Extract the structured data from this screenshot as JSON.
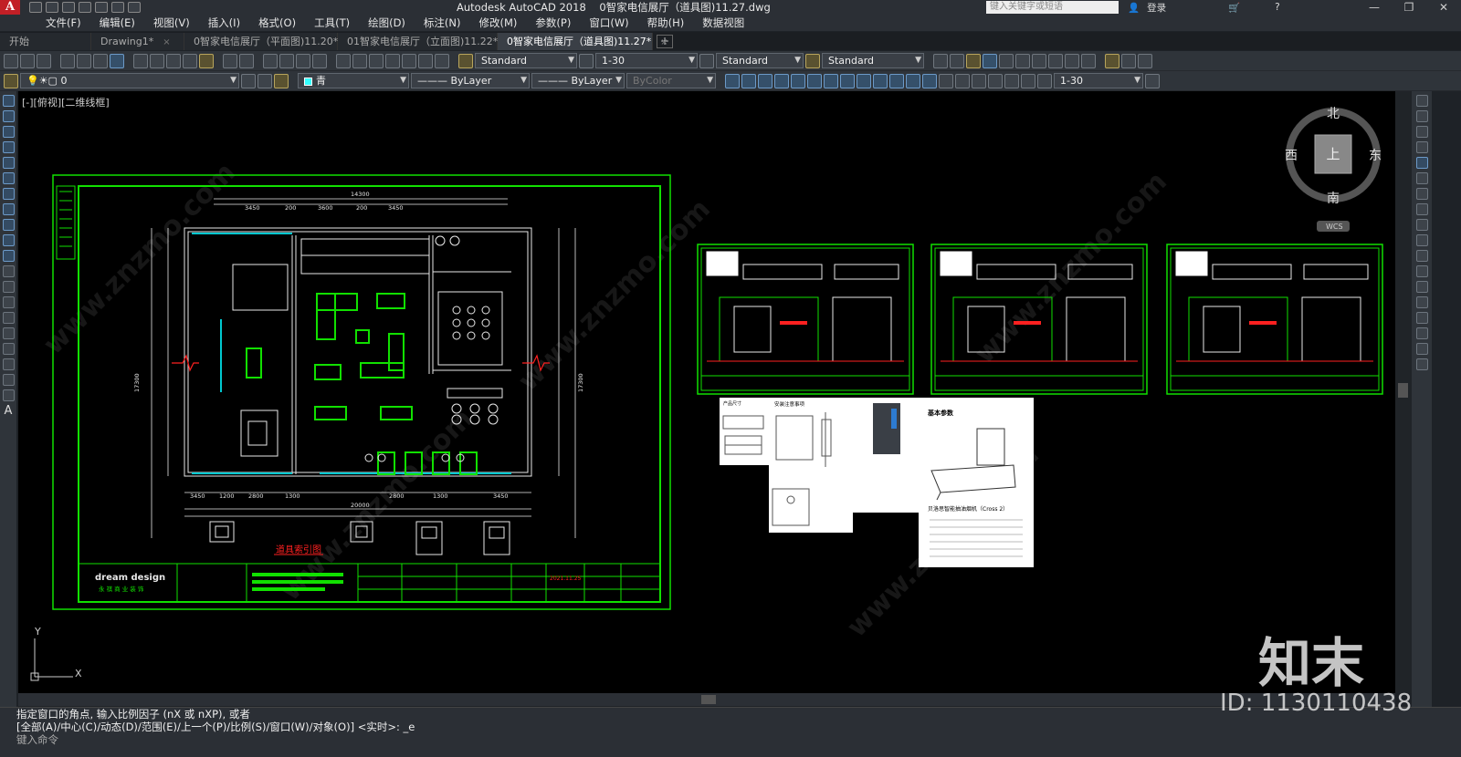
{
  "window": {
    "app_name": "Autodesk AutoCAD 2018",
    "file_name": "0智家电信展厅（道具图)11.27.dwg",
    "search_placeholder": "键入关键字或短语",
    "login": "登录"
  },
  "menu": [
    "文件(F)",
    "编辑(E)",
    "视图(V)",
    "插入(I)",
    "格式(O)",
    "工具(T)",
    "绘图(D)",
    "标注(N)",
    "修改(M)",
    "参数(P)",
    "窗口(W)",
    "帮助(H)",
    "数据视图"
  ],
  "tabs": [
    {
      "label": "开始",
      "close": ""
    },
    {
      "label": "Drawing1*",
      "close": "×"
    },
    {
      "label": "0智家电信展厅（平面图)11.20*",
      "close": "×"
    },
    {
      "label": "01智家电信展厅（立面图)11.22*",
      "close": "×"
    },
    {
      "label": "0智家电信展厅（道具图)11.27*",
      "close": "×"
    }
  ],
  "toolbar1": {
    "text_style": "Standard",
    "annotation_scale": "1-30",
    "dim_style": "Standard",
    "table_style": "Standard"
  },
  "toolbar2": {
    "layer": "0",
    "color": "青",
    "linetype": "ByLayer",
    "lineweight": "ByLayer",
    "plotstyle": "ByColor",
    "scale": "1-30"
  },
  "viewport_label": "[-][俯视][二维线框]",
  "viewcube": {
    "north": "北",
    "south": "南",
    "east": "东",
    "west": "西",
    "top": "上",
    "wcs": "WCS"
  },
  "ucs": {
    "x": "X",
    "y": "Y"
  },
  "drawing": {
    "plan_caption": "道具索引图",
    "title_block_company": "dream design",
    "title_block_sub": "永 祺 商 业 装 饰",
    "title_date": "2021.11.25",
    "dims_top": [
      "14300",
      "3450",
      "200",
      "3600",
      "200",
      "3450"
    ],
    "dims_bottom": [
      "3450",
      "1200",
      "2800",
      "1300",
      "2800",
      "1300",
      "3450"
    ],
    "dims_total": "20000",
    "dims_left": "17300",
    "card1_title": "产品尺寸",
    "card2_title": "安装注意事项",
    "card4_title": "基本参数",
    "card4_caption": "贝洛思智能抽油烟机（Cross 2）"
  },
  "command": {
    "line1": "指定窗口的角点, 输入比例因子 (nX 或 nXP), 或者",
    "line2": "[全部(A)/中心(C)/动态(D)/范围(E)/上一个(P)/比例(S)/窗口(W)/对象(O)] <实时>: _e",
    "prompt": "键入命令"
  },
  "watermarks": {
    "brand": "知末",
    "id": "ID: 1130110438",
    "site": "www.znzmo.com"
  },
  "colors": {
    "frame": "#11e000",
    "cyan": "#00c8d0",
    "red": "#ff2020",
    "bg": "#000000"
  }
}
